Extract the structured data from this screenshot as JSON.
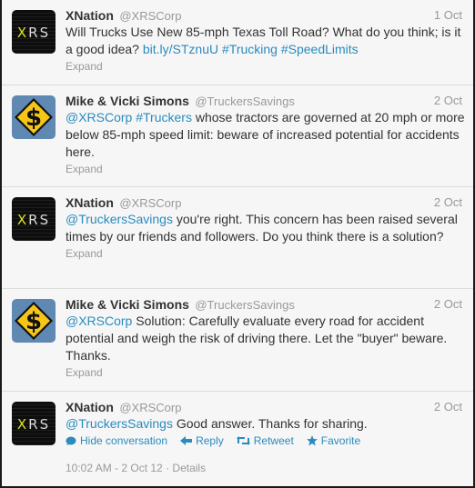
{
  "tweets": [
    {
      "name": "XNation",
      "handle": "@XRSCorp",
      "time": "1 Oct",
      "avatar": "xrs-logo",
      "text_plain": "Will Trucks Use New 85-mph Texas Toll Road? What do you think; is it a good idea?",
      "links": [
        "bit.ly/STznuU",
        "#Trucking",
        "#SpeedLimits"
      ],
      "expand": "Expand"
    },
    {
      "name": "Mike & Vicki Simons",
      "handle": "@TruckersSavings",
      "time": "2 Oct",
      "avatar": "dollar-sign",
      "mentions": [
        "@XRSCorp",
        "#Truckers"
      ],
      "text_plain": "whose tractors are governed at 20 mph or more below 85-mph speed limit: beware of increased potential for accidents here.",
      "expand": "Expand"
    },
    {
      "name": "XNation",
      "handle": "@XRSCorp",
      "time": "2 Oct",
      "avatar": "xrs-logo",
      "mention": "@TruckersSavings",
      "text_plain": "you're right. This concern has been raised several times by our friends and followers. Do you think there is a solution?",
      "expand": "Expand"
    },
    {
      "name": "Mike & Vicki Simons",
      "handle": "@TruckersSavings",
      "time": "2 Oct",
      "avatar": "dollar-sign",
      "mention": "@XRSCorp",
      "text_plain": "Solution: Carefully evaluate every road for accident potential and weigh the risk of driving there. Let the \"buyer\" beware. Thanks.",
      "expand": "Expand"
    },
    {
      "name": "XNation",
      "handle": "@XRSCorp",
      "time": "2 Oct",
      "avatar": "xrs-logo",
      "mention": "@TruckersSavings",
      "text_plain": "Good answer. Thanks for sharing.",
      "actions": {
        "hide_conversation": "Hide conversation",
        "reply": "Reply",
        "retweet": "Retweet",
        "favorite": "Favorite"
      },
      "timestamp": "10:02 AM - 2 Oct 12",
      "separator": "·",
      "details": "Details"
    }
  ],
  "avatar_logo": {
    "x": "X",
    "rs": "RS",
    "dollar": "$"
  },
  "colors": {
    "link": "#2a8bbf",
    "name": "#333333",
    "meta": "#999999",
    "background": "#f6f6f6"
  }
}
